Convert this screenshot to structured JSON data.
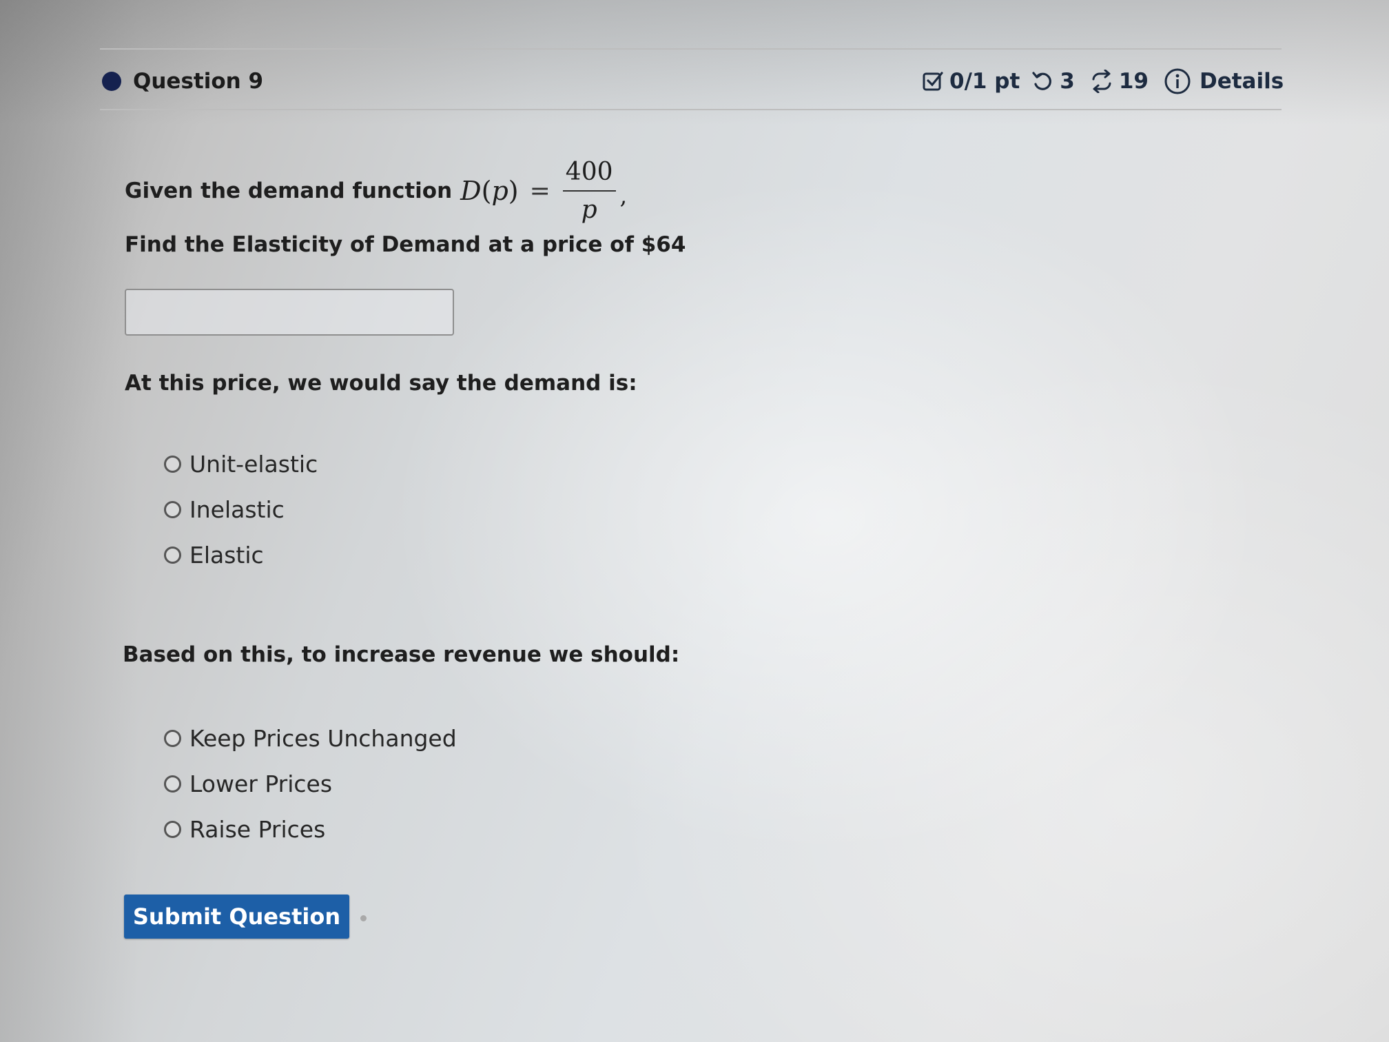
{
  "header": {
    "question_title": "Question 9",
    "score": "0/1 pt",
    "attempts": "3",
    "versions": "19",
    "details_label": "Details",
    "icons": [
      "status-dot",
      "score-check-icon",
      "retry-icon",
      "versions-icon",
      "info-icon"
    ]
  },
  "question": {
    "intro": "Given the demand function",
    "function_lhs": "D",
    "function_var": "p",
    "equals": "=",
    "numerator": "400",
    "denominator": "p",
    "trailing": ",",
    "find_text": "Find the Elasticity of Demand at a price of $64",
    "answer_value": "",
    "demand_prompt": "At this price, we would say the demand is:",
    "demand_options": [
      "Unit-elastic",
      "Inelastic",
      "Elastic"
    ],
    "revenue_prompt": "Based on this, to increase revenue we should:",
    "revenue_options": [
      "Keep Prices Unchanged",
      "Lower Prices",
      "Raise Prices"
    ]
  },
  "submit_label": "Submit Question",
  "colors": {
    "accent": "#1d5fa7",
    "status_dot": "#15214f",
    "header_text": "#1d2b40"
  }
}
